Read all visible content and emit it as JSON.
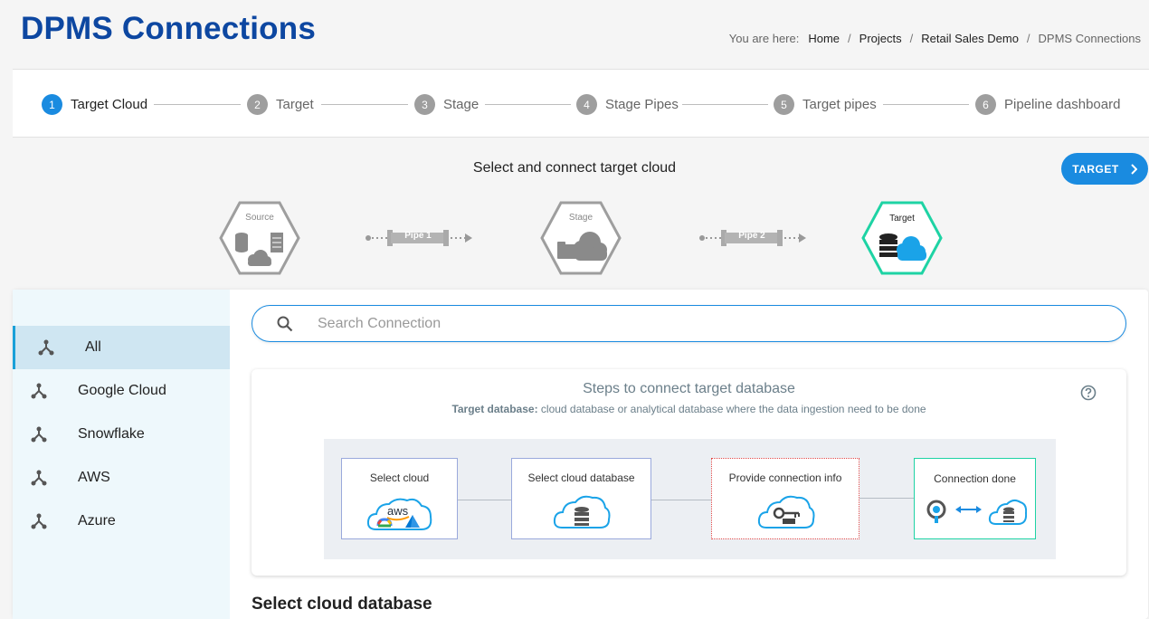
{
  "header": {
    "title": "DPMS Connections",
    "breadcrumb": {
      "lead": "You are here:",
      "items": [
        "Home",
        "Projects",
        "Retail Sales Demo"
      ],
      "current": "DPMS Connections",
      "separator": "/"
    }
  },
  "stepper": {
    "steps": [
      {
        "num": "1",
        "label": "Target Cloud"
      },
      {
        "num": "2",
        "label": "Target"
      },
      {
        "num": "3",
        "label": "Stage"
      },
      {
        "num": "4",
        "label": "Stage Pipes"
      },
      {
        "num": "5",
        "label": "Target pipes"
      },
      {
        "num": "6",
        "label": "Pipeline dashboard"
      }
    ],
    "active_color": "#1a8be0"
  },
  "section": {
    "title": "Select and connect target cloud",
    "next_button": "TARGET"
  },
  "pipeline": {
    "source_label": "Source",
    "pipe1_label": "Pipe 1",
    "stage_label": "Stage",
    "pipe2_label": "Pipe 2",
    "target_label": "Target",
    "highlight_color": "#1ed3a4"
  },
  "sidebar": {
    "items": [
      {
        "label": "All",
        "icon": "connection-node-icon"
      },
      {
        "label": "Google Cloud",
        "icon": "connection-node-icon"
      },
      {
        "label": "Snowflake",
        "icon": "connection-node-icon"
      },
      {
        "label": "AWS",
        "icon": "connection-node-icon"
      },
      {
        "label": "Azure",
        "icon": "connection-node-icon"
      }
    ]
  },
  "search": {
    "placeholder": "Search Connection",
    "value": ""
  },
  "steps_card": {
    "title": "Steps to connect target database",
    "subtitle_bold": "Target database:",
    "subtitle_rest": " cloud database or analytical database where the data ingestion need to be done",
    "flow": [
      {
        "label": "Select cloud",
        "icon": "cloud-providers-icon"
      },
      {
        "label": "Select cloud database",
        "icon": "cloud-database-icon"
      },
      {
        "label": "Provide connection info",
        "icon": "cloud-key-icon"
      },
      {
        "label": "Connection done",
        "icon": "connection-done-icon"
      }
    ],
    "aws_text": "aws"
  },
  "select_db": {
    "title": "Select cloud database"
  },
  "colors": {
    "brand": "#0d47a1",
    "accent": "#1a8be0",
    "sidebar_bg": "#eef8fc",
    "sidebar_active": "#cfe6f2",
    "success": "#1ed3a4"
  }
}
